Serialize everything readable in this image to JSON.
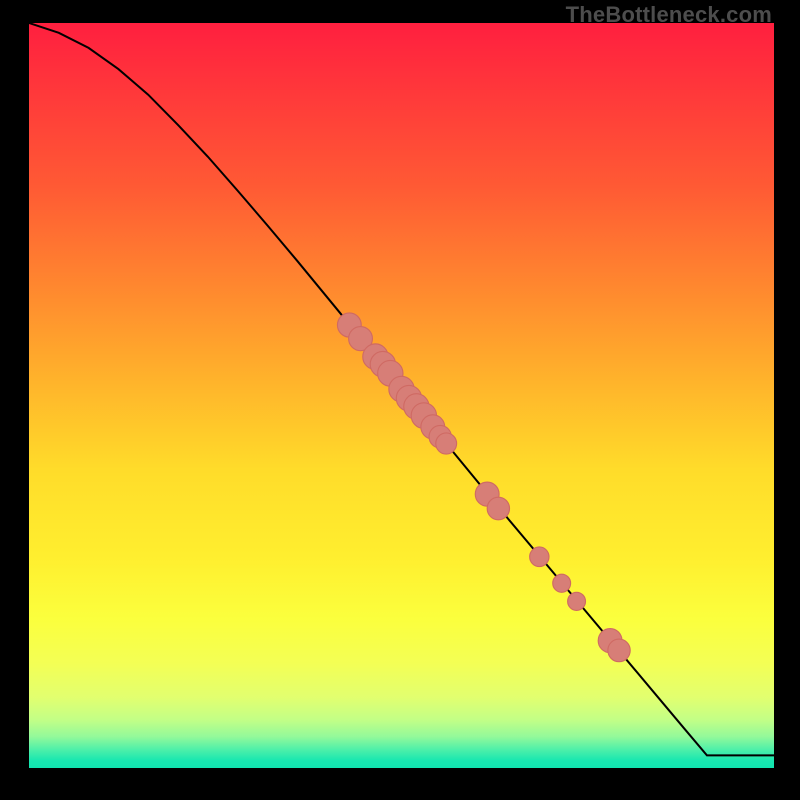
{
  "watermark": "TheBottleneck.com",
  "colors": {
    "frame": "#000000",
    "curve": "#000000",
    "marker_fill": "#d77e77",
    "marker_stroke": "#cf6a63",
    "gradient_stops": [
      {
        "offset": 0.0,
        "color": "#ff1f3f"
      },
      {
        "offset": 0.1,
        "color": "#ff3a3a"
      },
      {
        "offset": 0.22,
        "color": "#ff5a34"
      },
      {
        "offset": 0.35,
        "color": "#ff862f"
      },
      {
        "offset": 0.48,
        "color": "#ffb32b"
      },
      {
        "offset": 0.6,
        "color": "#ffdc2a"
      },
      {
        "offset": 0.72,
        "color": "#ffef2f"
      },
      {
        "offset": 0.8,
        "color": "#fbff3d"
      },
      {
        "offset": 0.86,
        "color": "#f3ff55"
      },
      {
        "offset": 0.905,
        "color": "#e2ff6f"
      },
      {
        "offset": 0.935,
        "color": "#c3ff86"
      },
      {
        "offset": 0.958,
        "color": "#93f99a"
      },
      {
        "offset": 0.975,
        "color": "#4ff0a9"
      },
      {
        "offset": 0.99,
        "color": "#18e7b0"
      },
      {
        "offset": 1.0,
        "color": "#11e4b0"
      }
    ]
  },
  "chart_data": {
    "type": "line",
    "title": "",
    "xlabel": "",
    "ylabel": "",
    "xlim": [
      0,
      100
    ],
    "ylim": [
      0,
      100
    ],
    "grid": false,
    "legend": false,
    "series": [
      {
        "name": "curve",
        "x": [
          0,
          4,
          8,
          12,
          16,
          20,
          24,
          28,
          32,
          36,
          40,
          44,
          48,
          52,
          56,
          60,
          64,
          68,
          72,
          76,
          80,
          84,
          88,
          91,
          100
        ],
        "y": [
          100,
          98.7,
          96.7,
          93.9,
          90.5,
          86.5,
          82.3,
          77.8,
          73.2,
          68.5,
          63.7,
          58.9,
          54.0,
          49.2,
          44.3,
          39.5,
          34.7,
          30.0,
          25.3,
          20.6,
          15.9,
          11.2,
          6.5,
          3.0,
          3.0
        ]
      }
    ],
    "markers": {
      "name": "highlighted-points",
      "points": [
        {
          "x": 43.0,
          "y": 60.0,
          "r": 1.6
        },
        {
          "x": 44.5,
          "y": 58.2,
          "r": 1.6
        },
        {
          "x": 46.5,
          "y": 55.8,
          "r": 1.7
        },
        {
          "x": 47.5,
          "y": 54.8,
          "r": 1.7
        },
        {
          "x": 48.5,
          "y": 53.6,
          "r": 1.7
        },
        {
          "x": 50.0,
          "y": 51.5,
          "r": 1.7
        },
        {
          "x": 51.0,
          "y": 50.3,
          "r": 1.7
        },
        {
          "x": 52.0,
          "y": 49.2,
          "r": 1.7
        },
        {
          "x": 53.0,
          "y": 48.0,
          "r": 1.7
        },
        {
          "x": 54.2,
          "y": 46.5,
          "r": 1.6
        },
        {
          "x": 55.2,
          "y": 45.2,
          "r": 1.5
        },
        {
          "x": 56.0,
          "y": 44.3,
          "r": 1.4
        },
        {
          "x": 61.5,
          "y": 37.6,
          "r": 1.6
        },
        {
          "x": 63.0,
          "y": 35.7,
          "r": 1.5
        },
        {
          "x": 68.5,
          "y": 29.3,
          "r": 1.3
        },
        {
          "x": 71.5,
          "y": 25.8,
          "r": 1.2
        },
        {
          "x": 73.5,
          "y": 23.4,
          "r": 1.2
        },
        {
          "x": 78.0,
          "y": 18.2,
          "r": 1.6
        },
        {
          "x": 79.2,
          "y": 16.9,
          "r": 1.5
        }
      ]
    }
  }
}
